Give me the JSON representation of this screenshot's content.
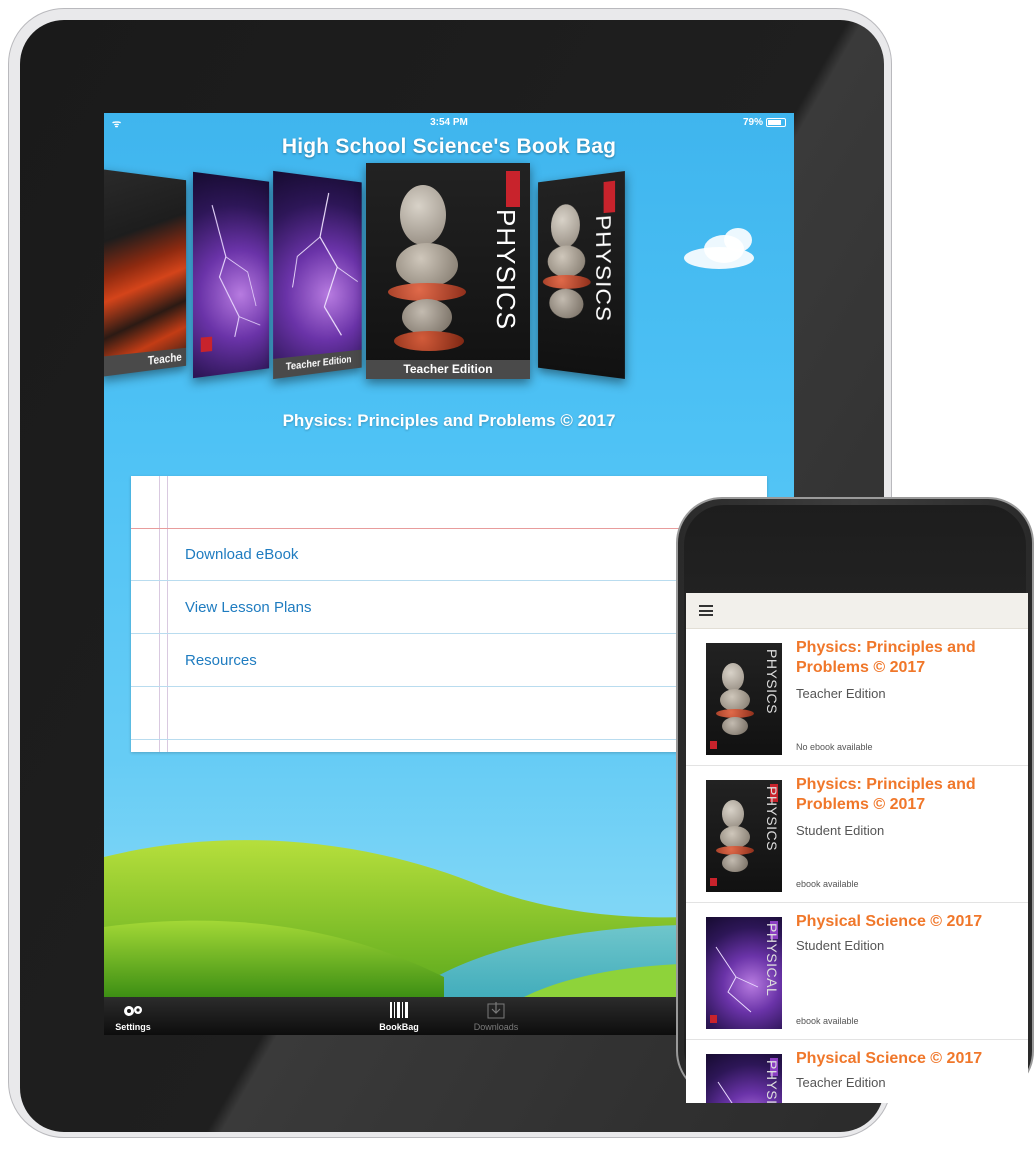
{
  "tablet": {
    "status_bar": {
      "wifi_icon": "wifi-icon",
      "time": "3:54 PM",
      "battery": "79%"
    },
    "app_title": "High School Science's Book Bag",
    "carousel": {
      "books": [
        {
          "label": "Teache",
          "cover": "lava"
        },
        {
          "label": "",
          "cover": "storm"
        },
        {
          "label": "Teacher Edition",
          "cover": "storm"
        },
        {
          "label": "Teacher Edition",
          "cover": "physics",
          "spine": "PHYSICS",
          "selected": true
        },
        {
          "label": "",
          "cover": "physics",
          "spine": "PHYSICS"
        }
      ]
    },
    "selected_book_title": "Physics: Principles and Problems © 2017",
    "menu": {
      "items": [
        {
          "label": "Download eBook"
        },
        {
          "label": "View Lesson Plans"
        },
        {
          "label": "Resources"
        }
      ]
    },
    "tab_bar": {
      "tabs": [
        {
          "label": "Settings",
          "icon": "gears-icon"
        },
        {
          "label": "BookBag",
          "icon": "barcode-icon"
        },
        {
          "label": "Downloads",
          "icon": "download-icon"
        }
      ]
    }
  },
  "phone": {
    "header": {
      "menu_icon": "hamburger-icon"
    },
    "list": [
      {
        "title": "Physics: Principles and Problems © 2017",
        "edition": "Teacher Edition",
        "status": "No ebook available",
        "cover_spine": "PHYSICS"
      },
      {
        "title": "Physics: Principles and Problems © 2017",
        "edition": "Student Edition",
        "status": "ebook available",
        "cover_spine": "PHYSICS"
      },
      {
        "title": "Physical Science © 2017",
        "edition": "Student Edition",
        "status": "ebook available",
        "cover_spine": "PHYSICAL"
      },
      {
        "title": "Physical Science © 2017",
        "edition": "Teacher Edition",
        "status": "",
        "cover_spine": "PHYSICAL"
      }
    ]
  },
  "colors": {
    "sky": "#4ec2f5",
    "link_blue": "#1f7cc0",
    "title_orange": "#f0772a",
    "tab_bar": "#111111"
  }
}
